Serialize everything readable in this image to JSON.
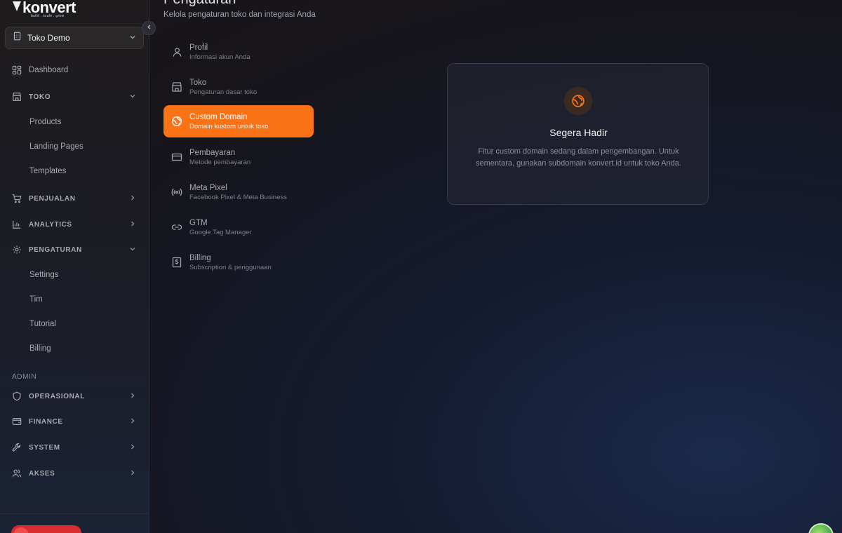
{
  "brand": {
    "name": "konvert",
    "tagline": "build . scale . grow"
  },
  "store_selector": {
    "value": "Toko Demo"
  },
  "sidebar": {
    "dashboard": "Dashboard",
    "toko": {
      "label": "TOKO",
      "items": [
        "Products",
        "Landing Pages",
        "Templates"
      ]
    },
    "penjualan": "PENJUALAN",
    "analytics": "ANALYTICS",
    "pengaturan": {
      "label": "PENGATURAN",
      "items": [
        "Settings",
        "Tim",
        "Tutorial",
        "Billing"
      ]
    },
    "admin_label": "ADMIN",
    "operasional": "OPERASIONAL",
    "finance": "FINANCE",
    "system": "SYSTEM",
    "akses": "AKSES"
  },
  "header": {
    "title": "Pengaturan",
    "subtitle": "Kelola pengaturan toko dan integrasi Anda"
  },
  "settings_menu": [
    {
      "title": "Profil",
      "desc": "Informasi akun Anda",
      "icon": "user-icon"
    },
    {
      "title": "Toko",
      "desc": "Pengaturan dasar toko",
      "icon": "store-icon"
    },
    {
      "title": "Custom Domain",
      "desc": "Domain kustom untuk toko",
      "icon": "globe-icon",
      "active": true
    },
    {
      "title": "Pembayaran",
      "desc": "Metode pembayaran",
      "icon": "credit-card-icon"
    },
    {
      "title": "Meta Pixel",
      "desc": "Facebook Pixel & Meta Business",
      "icon": "radio-icon"
    },
    {
      "title": "GTM",
      "desc": "Google Tag Manager",
      "icon": "link-icon"
    },
    {
      "title": "Billing",
      "desc": "Subscription & penggunaan",
      "icon": "receipt-icon"
    }
  ],
  "card": {
    "icon": "globe-icon",
    "title": "Segera Hadir",
    "description": "Fitur custom domain sedang dalam pengembangan. Untuk sementara, gunakan subdomain konvert.id untuk toko Anda."
  },
  "colors": {
    "accent": "#f97316",
    "danger": "#d92d2d"
  }
}
